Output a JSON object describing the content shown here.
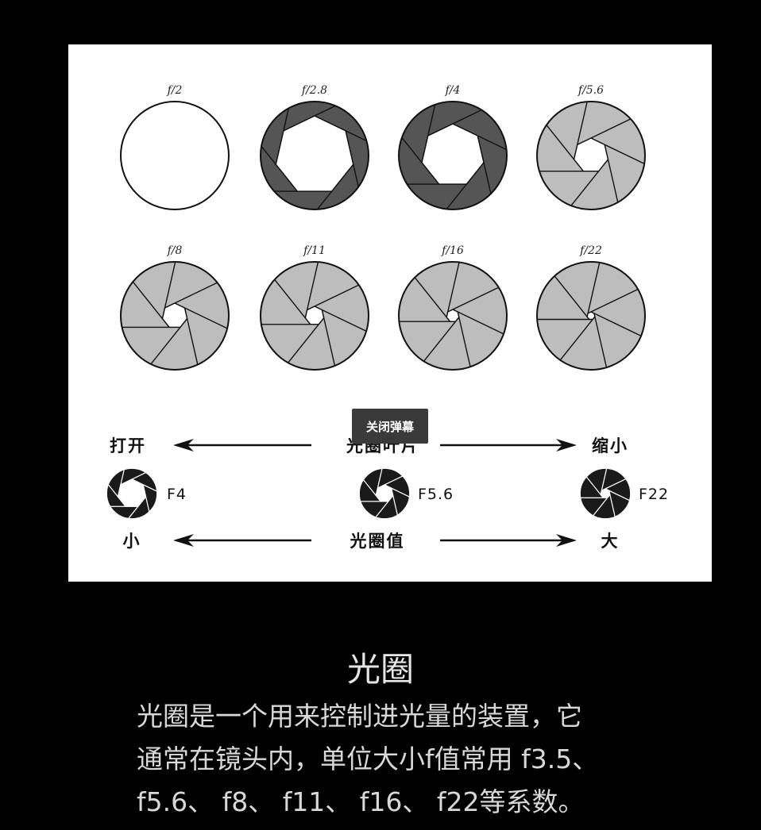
{
  "apertures": [
    "f/2",
    "f/2.8",
    "f/4",
    "f/5.6",
    "f/8",
    "f/11",
    "f/16",
    "f/22"
  ],
  "diagram": {
    "row1": {
      "left": "打开",
      "center": "光圈叶片",
      "right": "缩小"
    },
    "samples": [
      "F4",
      "F5.6",
      "F22"
    ],
    "row2": {
      "left": "小",
      "center": "光圈值",
      "right": "大"
    }
  },
  "overlay": {
    "danmaku_button": "关闭弹幕"
  },
  "caption": {
    "title": "光圈",
    "lines": [
      "光圈是一个用来控制进光量的装置，它",
      "通常在镜头内，单位大小f值常用 f3.5、",
      "f5.6、 f8、 f11、 f16、 f22等系数。"
    ]
  },
  "colors": {
    "background": "#000000",
    "figure": "#ffffff",
    "blade_dark": "#555555",
    "blade_light": "#bdbdbd",
    "sample_blade": "#1a1a1a"
  }
}
